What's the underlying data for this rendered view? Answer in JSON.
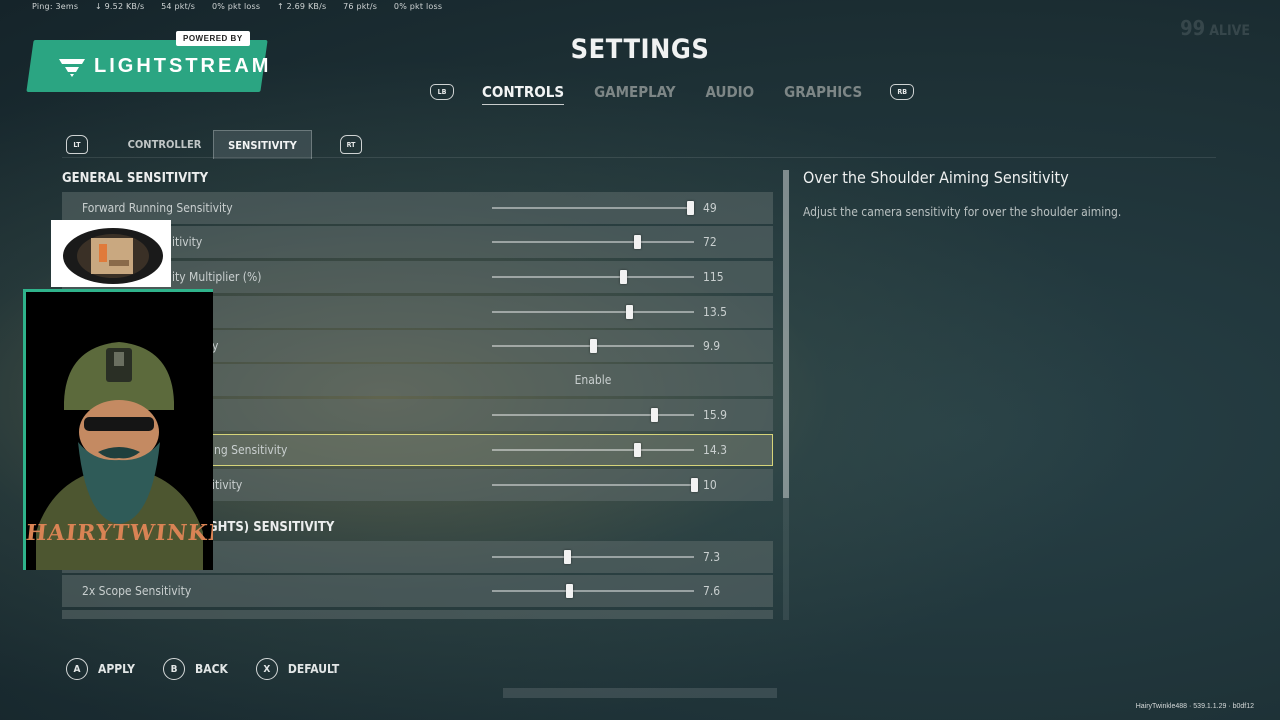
{
  "stream_stats": {
    "ping": "Ping: 3ems",
    "down_rate": "↓ 9.52 KB/s",
    "down_pkts": "54 pkt/s",
    "down_loss": "0% pkt loss",
    "up_rate": "↑ 2.69 KB/s",
    "up_pkts": "76 pkt/s",
    "up_loss": "0% pkt loss"
  },
  "alive": {
    "count": "99",
    "label": "ALIVE"
  },
  "lightstream": {
    "powered_by": "POWERED BY",
    "brand": "LIGHTSTREAM",
    "brand_color": "#2ba582"
  },
  "header": {
    "title": "SETTINGS"
  },
  "main_tabs": {
    "left_bumper": "LB",
    "right_bumper": "RB",
    "items": [
      {
        "label": "CONTROLS",
        "active": true
      },
      {
        "label": "GAMEPLAY",
        "active": false
      },
      {
        "label": "AUDIO",
        "active": false
      },
      {
        "label": "GRAPHICS",
        "active": false
      }
    ]
  },
  "sub_tabs": {
    "left_trigger": "LT",
    "right_trigger": "RT",
    "items": [
      {
        "label": "CONTROLLER",
        "active": false
      },
      {
        "label": "SENSITIVITY",
        "active": true
      }
    ]
  },
  "sections": {
    "general": "GENERAL SENSITIVITY",
    "scope": "GHTS) SENSITIVITY"
  },
  "rows": [
    {
      "label": "Forward Running Sensitivity",
      "value": "49",
      "fraction": 0.98
    },
    {
      "label": "itivity",
      "value": "72",
      "fraction": 0.72
    },
    {
      "label": "ity Multiplier (%)",
      "value": "115",
      "fraction": 0.65
    },
    {
      "label": "",
      "value": "13.5",
      "fraction": 0.68
    },
    {
      "label": "y",
      "value": "9.9",
      "fraction": 0.5
    },
    {
      "label": "",
      "toggle": "Enable"
    },
    {
      "label": "",
      "value": "15.9",
      "fraction": 0.8
    },
    {
      "label": "ng Sensitivity",
      "value": "14.3",
      "fraction": 0.72,
      "selected": true
    },
    {
      "label": "itivity",
      "value": "10",
      "fraction": 1.0
    },
    {
      "label": "",
      "value": "7.3",
      "fraction": 0.37
    },
    {
      "label": "2x Scope Sensitivity",
      "value": "7.6",
      "fraction": 0.38
    }
  ],
  "description": {
    "title": "Over the Shoulder Aiming Sensitivity",
    "text": "Adjust the camera sensitivity for over the shoulder aiming."
  },
  "footer": {
    "apply": {
      "key": "A",
      "label": "APPLY"
    },
    "back": {
      "key": "B",
      "label": "BACK"
    },
    "default": {
      "key": "X",
      "label": "DEFAULT"
    }
  },
  "build": "HairyTwinkle488 · 539.1.1.29 · b0df12",
  "overlay": {
    "name": "HAIRYTWINKLE",
    "accent": "#2fb38b"
  }
}
